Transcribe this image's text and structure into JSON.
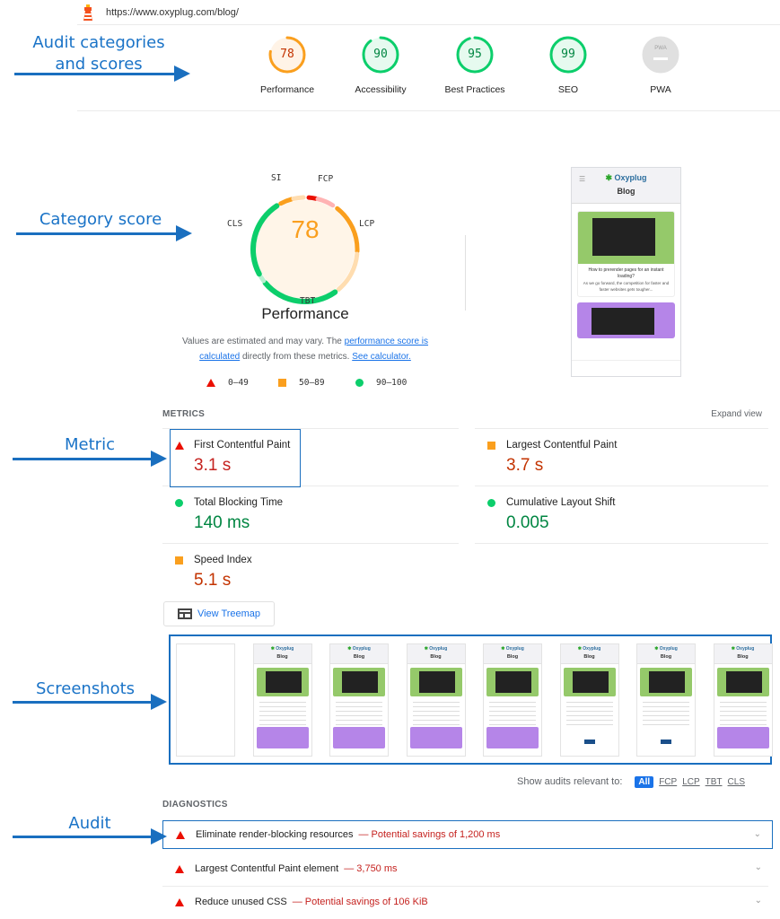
{
  "header": {
    "url": "https://www.oxyplug.com/blog/",
    "icon": "lighthouse-icon"
  },
  "annotations": {
    "categories": "Audit categories and scores",
    "category_line1": "Audit categories",
    "category_line2": "and scores",
    "category_score": "Category score",
    "metric": "Metric",
    "screenshots": "Screenshots",
    "audit": "Audit",
    "color": "#1a6fbf"
  },
  "categories": [
    {
      "label": "Performance",
      "score": "78",
      "value": 78,
      "status": "average"
    },
    {
      "label": "Accessibility",
      "score": "90",
      "value": 90,
      "status": "pass"
    },
    {
      "label": "Best Practices",
      "score": "95",
      "value": 95,
      "status": "pass"
    },
    {
      "label": "SEO",
      "score": "99",
      "value": 99,
      "status": "pass"
    },
    {
      "label": "PWA",
      "score": "PWA",
      "value": null,
      "status": "na"
    }
  ],
  "colors": {
    "fail": "#eb0f00",
    "average": "#fa9f1e",
    "pass": "#0cce6b",
    "na": "#e0e0e0",
    "link": "#1a73e8"
  },
  "performance": {
    "score": "78",
    "value": 78,
    "title": "Performance",
    "metric_labels": {
      "si": "SI",
      "fcp": "FCP",
      "lcp": "LCP",
      "tbt": "TBT",
      "cls": "CLS"
    },
    "description_prefix": "Values are estimated and may vary. The ",
    "description_link1": "performance score is calculated",
    "description_middle": " directly from these metrics. ",
    "description_link2": "See calculator.",
    "legend": [
      {
        "shape": "triangle",
        "range": "0–49"
      },
      {
        "shape": "square",
        "range": "50–89"
      },
      {
        "shape": "circle",
        "range": "90–100"
      }
    ]
  },
  "preview": {
    "brand": "Oxyplug",
    "page_title": "Blog",
    "post_title": "How to prerender pages for an instant loading?",
    "post_excerpt": "As we go forward, the competition for faster and faster websites gets tougher..."
  },
  "metrics": {
    "heading": "METRICS",
    "expand": "Expand view",
    "items": [
      {
        "name": "First Contentful Paint",
        "value": "3.1 s",
        "status": "fail"
      },
      {
        "name": "Largest Contentful Paint",
        "value": "3.7 s",
        "status": "average"
      },
      {
        "name": "Total Blocking Time",
        "value": "140 ms",
        "status": "pass"
      },
      {
        "name": "Cumulative Layout Shift",
        "value": "0.005",
        "status": "pass"
      },
      {
        "name": "Speed Index",
        "value": "5.1 s",
        "status": "average"
      }
    ]
  },
  "treemap": {
    "label": "View Treemap"
  },
  "filmstrip": {
    "frame_count": 8,
    "brand": "Oxyplug",
    "page_title": "Blog"
  },
  "filter": {
    "label": "Show audits relevant to:",
    "options": [
      "All",
      "FCP",
      "LCP",
      "TBT",
      "CLS"
    ],
    "selected": "All"
  },
  "diagnostics": {
    "heading": "DIAGNOSTICS",
    "items": [
      {
        "title": "Eliminate render-blocking resources",
        "detail": "— Potential savings of 1,200 ms",
        "status": "fail"
      },
      {
        "title": "Largest Contentful Paint element",
        "detail": "— 3,750 ms",
        "status": "fail"
      },
      {
        "title": "Reduce unused CSS",
        "detail": "— Potential savings of 106 KiB",
        "status": "fail"
      }
    ]
  }
}
